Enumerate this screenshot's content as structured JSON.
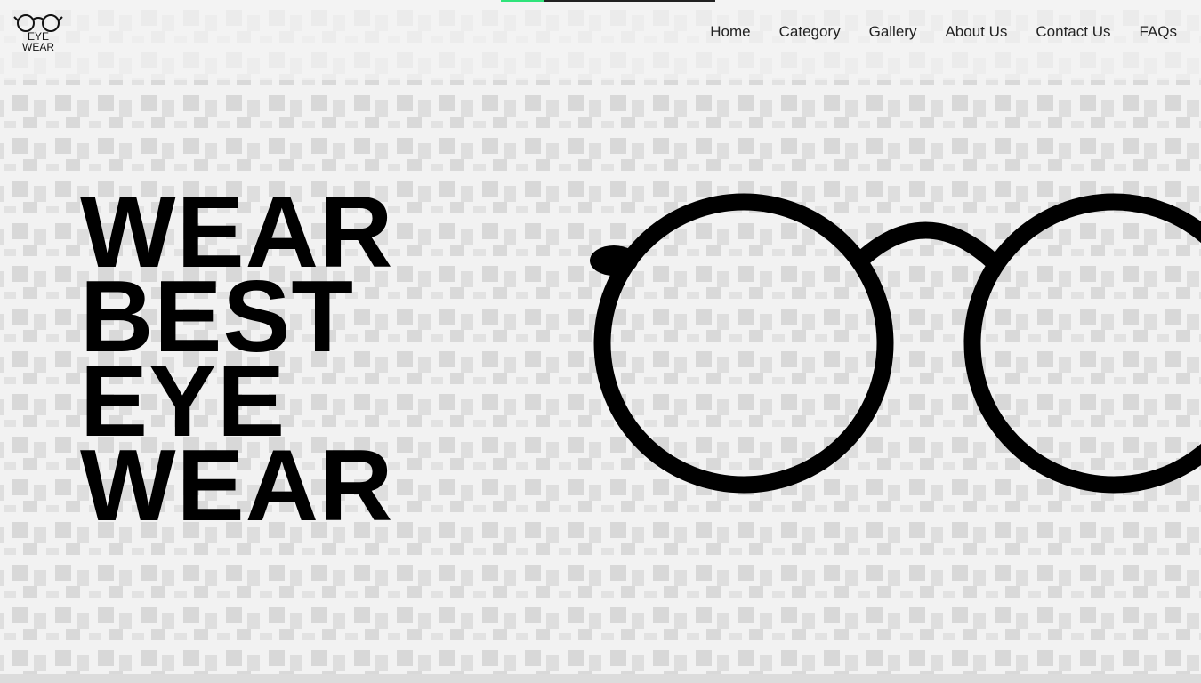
{
  "logo": {
    "line1": "EYE",
    "line2": "WEAR"
  },
  "nav": {
    "items": [
      {
        "label": "Home"
      },
      {
        "label": "Category"
      },
      {
        "label": "Gallery"
      },
      {
        "label": "About Us"
      },
      {
        "label": "Contact Us"
      },
      {
        "label": "FAQs"
      }
    ]
  },
  "hero": {
    "lines": [
      "WEAR",
      "BEST",
      "EYE",
      "WEAR"
    ]
  },
  "scroll_indicator": {
    "progress": 0.2,
    "progress_color": "#2ee37a",
    "track_color": "#222222"
  },
  "icons": {
    "logo": "glasses-logo-icon",
    "hero": "round-glasses-icon"
  }
}
